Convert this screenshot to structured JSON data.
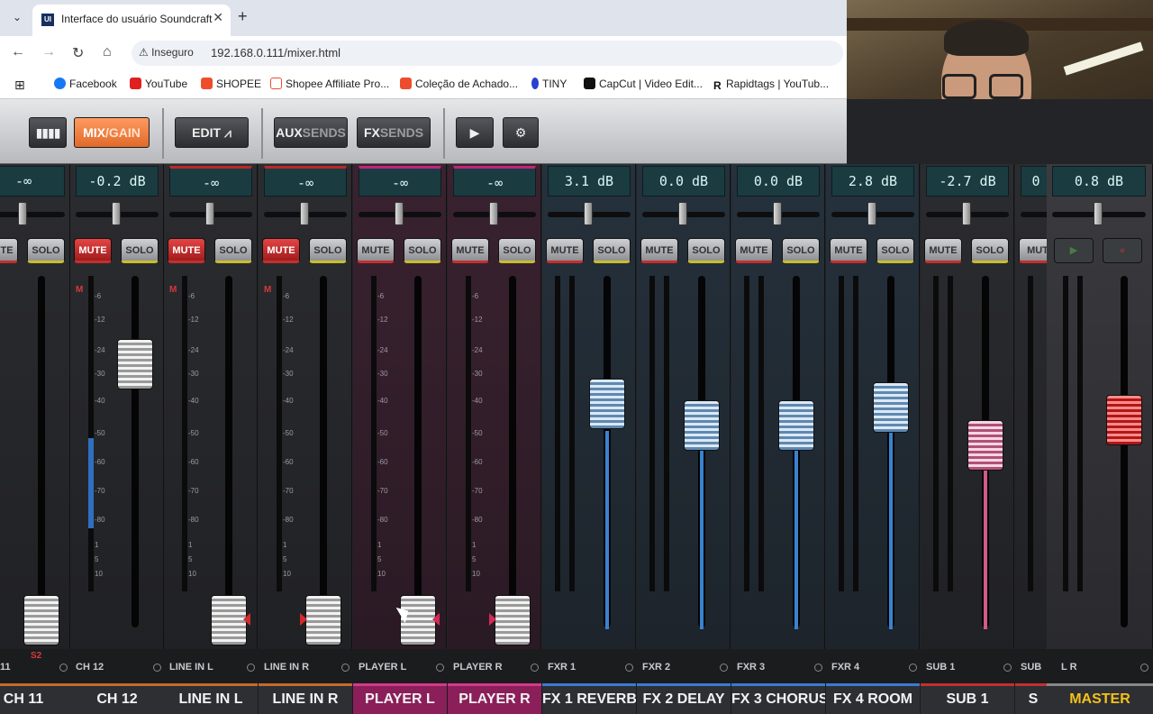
{
  "browser": {
    "tab_title": "Interface do usuário Soundcraft",
    "favicon_text": "UI",
    "insecure_label": "Inseguro",
    "url": "192.168.0.111/mixer.html",
    "bookmarks": [
      {
        "label": "Facebook",
        "color": "#1877f2"
      },
      {
        "label": "YouTube",
        "color": "#e02020"
      },
      {
        "label": "SHOPEE",
        "color": "#ee4d2d"
      },
      {
        "label": "Shopee Affiliate Pro...",
        "color": "#ee4d2d"
      },
      {
        "label": "Coleção de Achado...",
        "color": "#ee4d2d"
      },
      {
        "label": "TINY",
        "color": "#2742d0"
      },
      {
        "label": "CapCut | Video Edit...",
        "color": "#111111"
      },
      {
        "label": "Rapidtags | YouTub...",
        "color": "#111111"
      }
    ]
  },
  "toolbar": {
    "mix_a": "MIX",
    "mix_b": "/GAIN",
    "edit": "EDIT",
    "aux_a": "AUX",
    "aux_b": "SENDS",
    "fx_a": "FX",
    "fx_b": "SENDS"
  },
  "channels": [
    {
      "db": "-∞",
      "short": "11",
      "name": "CH 11",
      "mute": "MUTE",
      "solo": "SOLO"
    },
    {
      "db": "-0.2 dB",
      "short": "CH 12",
      "name": "CH 12",
      "mute": "MUTE",
      "solo": "SOLO"
    },
    {
      "db": "-∞",
      "short": "LINE IN L",
      "name": "LINE IN L",
      "mute": "MUTE",
      "solo": "SOLO"
    },
    {
      "db": "-∞",
      "short": "LINE IN R",
      "name": "LINE IN R",
      "mute": "MUTE",
      "solo": "SOLO"
    },
    {
      "db": "-∞",
      "short": "PLAYER L",
      "name": "PLAYER L",
      "mute": "MUTE",
      "solo": "SOLO"
    },
    {
      "db": "-∞",
      "short": "PLAYER R",
      "name": "PLAYER R",
      "mute": "MUTE",
      "solo": "SOLO"
    },
    {
      "db": "3.1 dB",
      "short": "FXR 1",
      "name": "FX 1 REVERB",
      "mute": "MUTE",
      "solo": "SOLO"
    },
    {
      "db": "0.0 dB",
      "short": "FXR 2",
      "name": "FX 2 DELAY",
      "mute": "MUTE",
      "solo": "SOLO"
    },
    {
      "db": "0.0 dB",
      "short": "FXR 3",
      "name": "FX 3 CHORUS",
      "mute": "MUTE",
      "solo": "SOLO"
    },
    {
      "db": "2.8 dB",
      "short": "FXR 4",
      "name": "FX 4 ROOM",
      "mute": "MUTE",
      "solo": "SOLO"
    },
    {
      "db": "-2.7 dB",
      "short": "SUB 1",
      "name": "SUB 1",
      "mute": "MUTE",
      "solo": "SOLO"
    },
    {
      "db": "0",
      "short": "SUB",
      "name": "S",
      "mute": "MUT",
      "solo": ""
    },
    {
      "db": "0.8 dB",
      "short": "L  R",
      "name": "MASTER",
      "mute": "",
      "solo": ""
    }
  ],
  "scale": [
    "-6",
    "-12",
    "-24",
    "-30",
    "-40",
    "-50",
    "-60",
    "-70",
    "-80",
    "1",
    "5",
    "10"
  ],
  "badges": {
    "m": "M",
    "s2": "S2"
  }
}
